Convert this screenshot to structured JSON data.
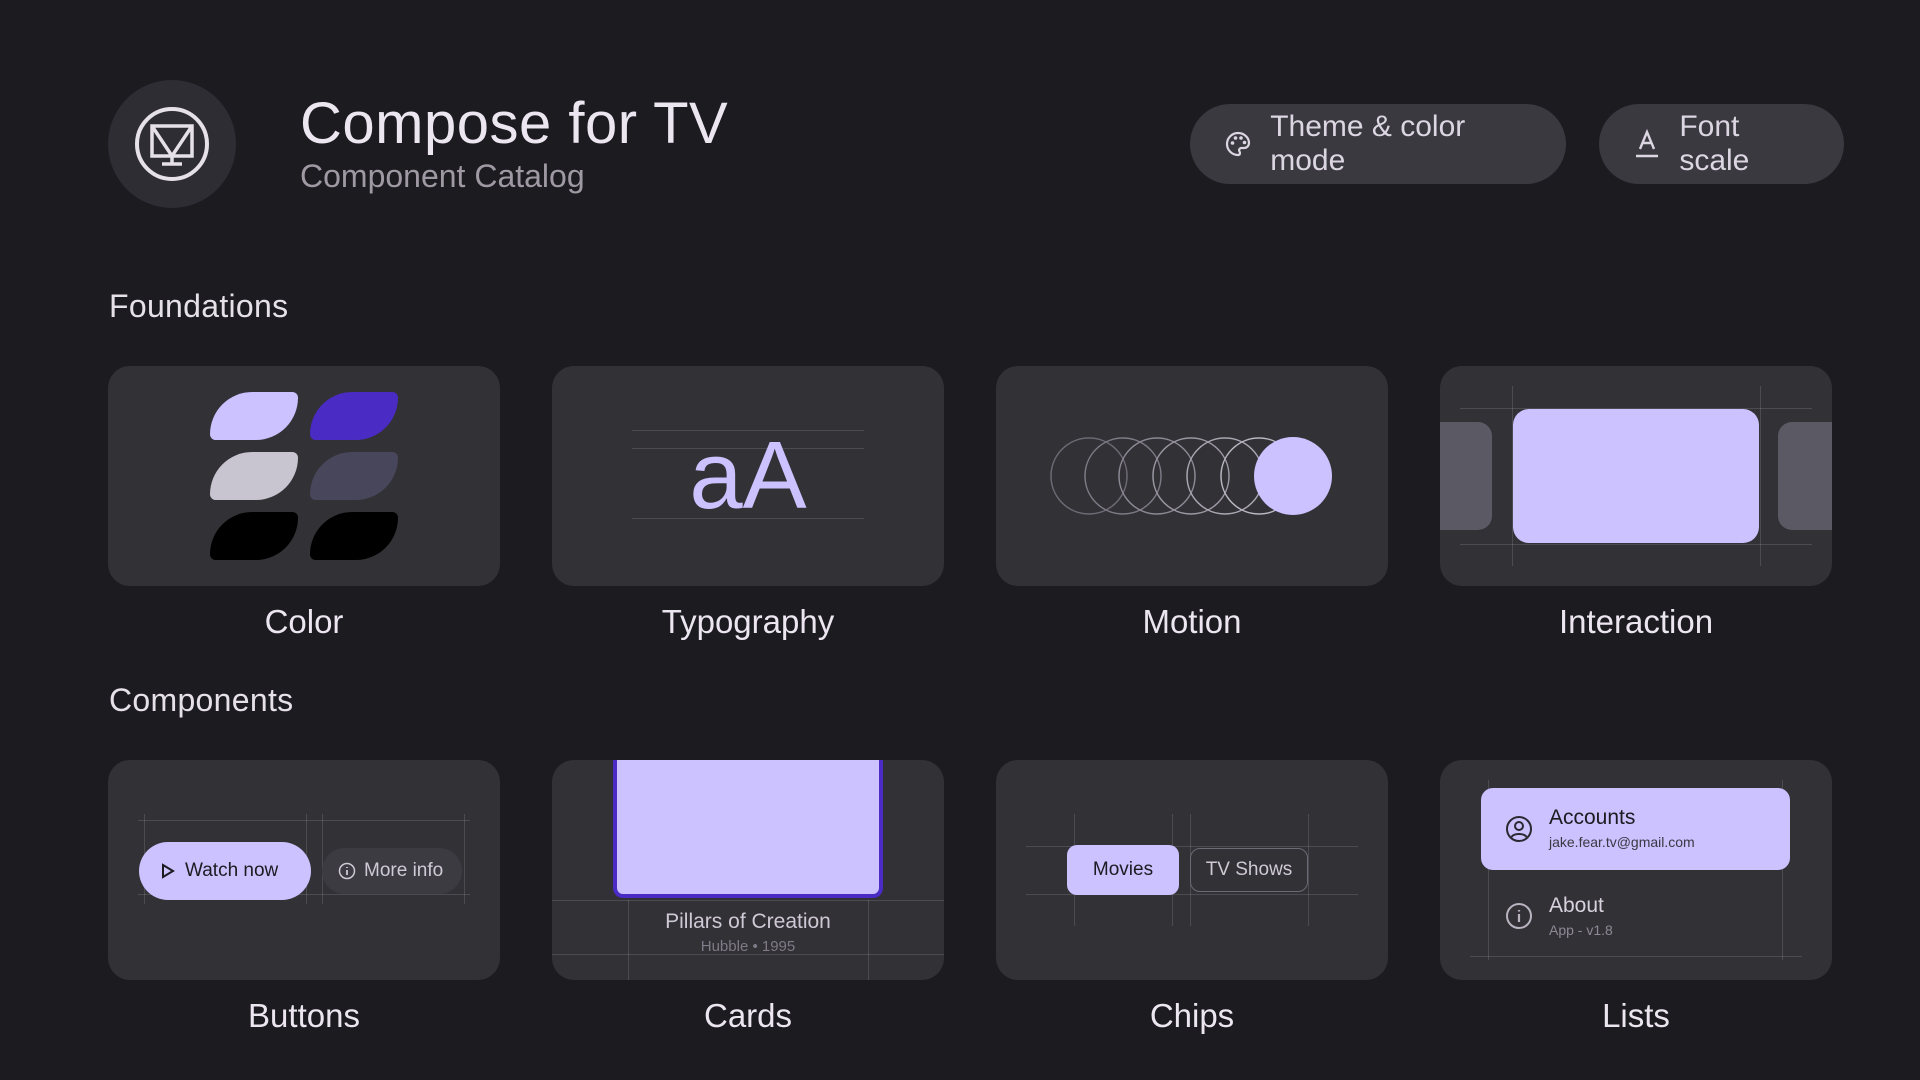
{
  "header": {
    "title": "Compose for TV",
    "subtitle": "Component Catalog",
    "logo_icon": "tv-logo-icon",
    "theme_button": {
      "label": "Theme & color mode",
      "icon": "palette-icon"
    },
    "font_button": {
      "label": "Font scale",
      "icon": "text-format-icon"
    }
  },
  "sections": {
    "foundations": "Foundations",
    "components": "Components"
  },
  "foundation_cards": [
    {
      "label": "Color"
    },
    {
      "label": "Typography",
      "sample": "aA"
    },
    {
      "label": "Motion"
    },
    {
      "label": "Interaction"
    }
  ],
  "component_cards": [
    {
      "label": "Buttons",
      "primary_button": "Watch now",
      "secondary_button": "More info"
    },
    {
      "label": "Cards",
      "card_title": "Pillars of Creation",
      "card_subtitle": "Hubble • 1995"
    },
    {
      "label": "Chips",
      "chip_selected": "Movies",
      "chip_other": "TV Shows"
    },
    {
      "label": "Lists",
      "items": [
        {
          "title": "Accounts",
          "subtitle": "jake.fear.tv@gmail.com"
        },
        {
          "title": "About",
          "subtitle": "App - v1.8"
        }
      ]
    }
  ],
  "colors": {
    "background": "#1c1b20",
    "surface": "#323136",
    "accent": "#cbc2ff",
    "accent_dark": "#4a2bc4"
  }
}
